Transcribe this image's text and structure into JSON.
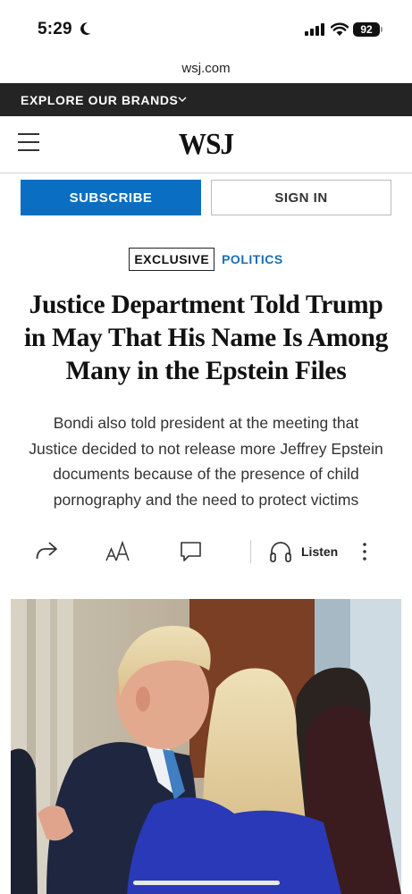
{
  "status_bar": {
    "time": "5:29",
    "battery": "92"
  },
  "url_bar": {
    "domain": "wsj.com"
  },
  "brands_bar": {
    "label": "EXPLORE OUR BRANDS"
  },
  "header": {
    "logo": "WSJ"
  },
  "auth": {
    "subscribe_label": "SUBSCRIBE",
    "sign_in_label": "SIGN IN"
  },
  "article": {
    "flag": "EXCLUSIVE",
    "section": "POLITICS",
    "headline_lines": [
      "Justice Department Told Trump",
      "in May That His Name Is Among",
      "Many in the Epstein Files"
    ],
    "dek_lines": [
      "Bondi also told president at the meeting that",
      "Justice decided to not release more Jeffrey Epstein",
      "documents because of the presence of child",
      "pornography and the need to protect victims"
    ]
  },
  "tools": {
    "listen_label": "Listen"
  },
  "icons": [
    "moon-icon",
    "signal-icon",
    "wifi-icon",
    "chevron-down-icon",
    "menu-icon",
    "share-icon",
    "text-size-icon",
    "comment-icon",
    "headphones-icon",
    "more-icon"
  ],
  "colors": {
    "accent": "#0a6fc2",
    "section": "#1a6fb5",
    "brands_bar": "#242424"
  }
}
